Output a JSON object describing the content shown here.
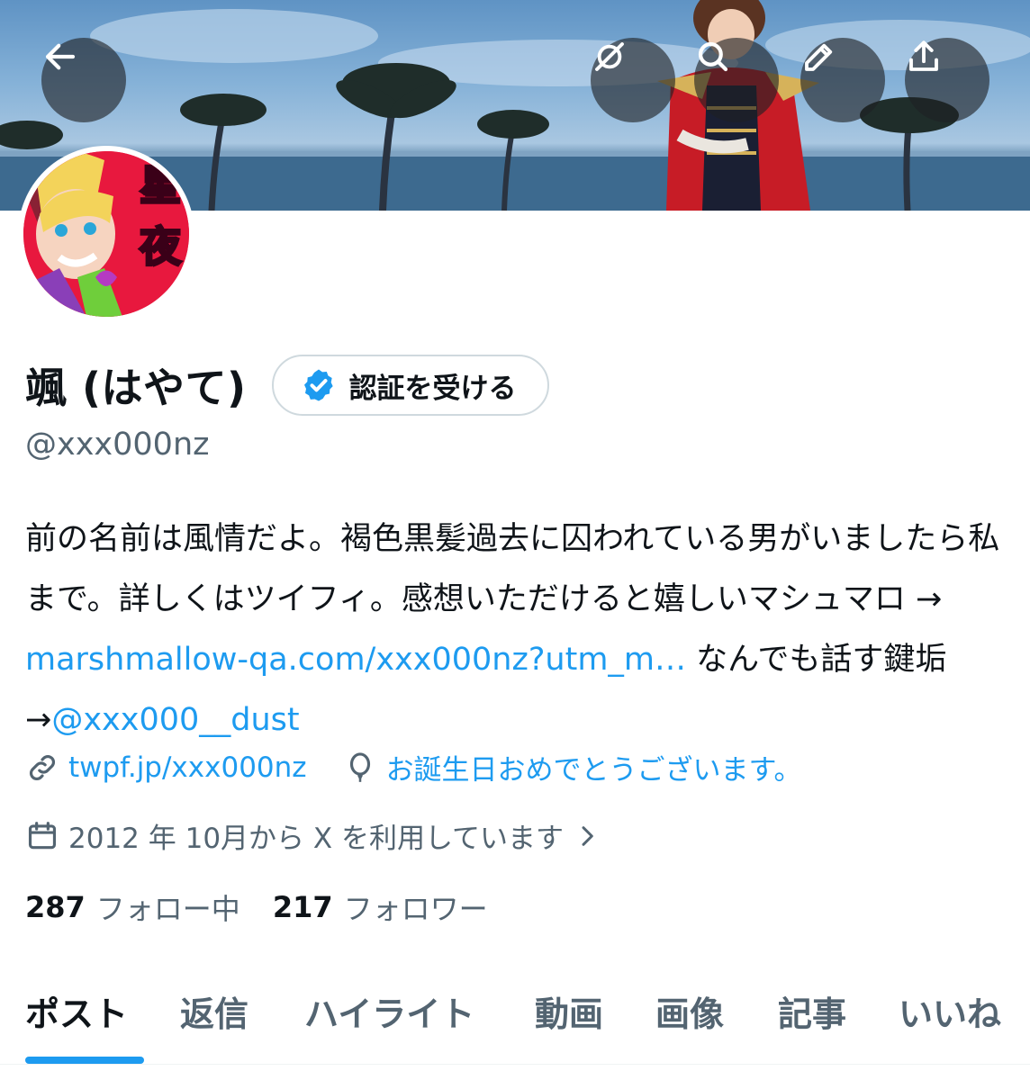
{
  "header": {
    "back_icon": "arrow-left-icon",
    "grok_icon": "grok-icon",
    "search_icon": "search-icon",
    "edit_icon": "pencil-icon",
    "share_icon": "share-icon"
  },
  "profile": {
    "avatar_text": "星夜",
    "display_name": "颯 (はやて)",
    "verify_label": "認証を受ける",
    "handle": "@xxx000nz",
    "bio": {
      "text": "前の名前は風情だよ。褐色黒髪過去に囚われている男がいましたら私まで。詳しくはツイフィ。感想いただけると嬉しいマシュマロ → ",
      "link1": "marshmallow-qa.com/xxx000nz?utm_m…",
      "text2": " なんでも話す鍵垢 →",
      "link2": "@xxx000__dust"
    },
    "website": "twpf.jp/xxx000nz",
    "birthday": "お誕生日おめでとうございます。",
    "joined": "2012 年 10月から X を利用しています",
    "following_count": "287",
    "following_label": "フォロー中",
    "followers_count": "217",
    "followers_label": "フォロワー"
  },
  "tabs": [
    {
      "label": "ポスト",
      "active": true
    },
    {
      "label": "返信"
    },
    {
      "label": "ハイライト"
    },
    {
      "label": "動画"
    },
    {
      "label": "画像"
    },
    {
      "label": "記事"
    },
    {
      "label": "いいね"
    }
  ],
  "colors": {
    "accent": "#1d9bf0",
    "secondary_text": "#536471",
    "primary_text": "#0f1419"
  }
}
